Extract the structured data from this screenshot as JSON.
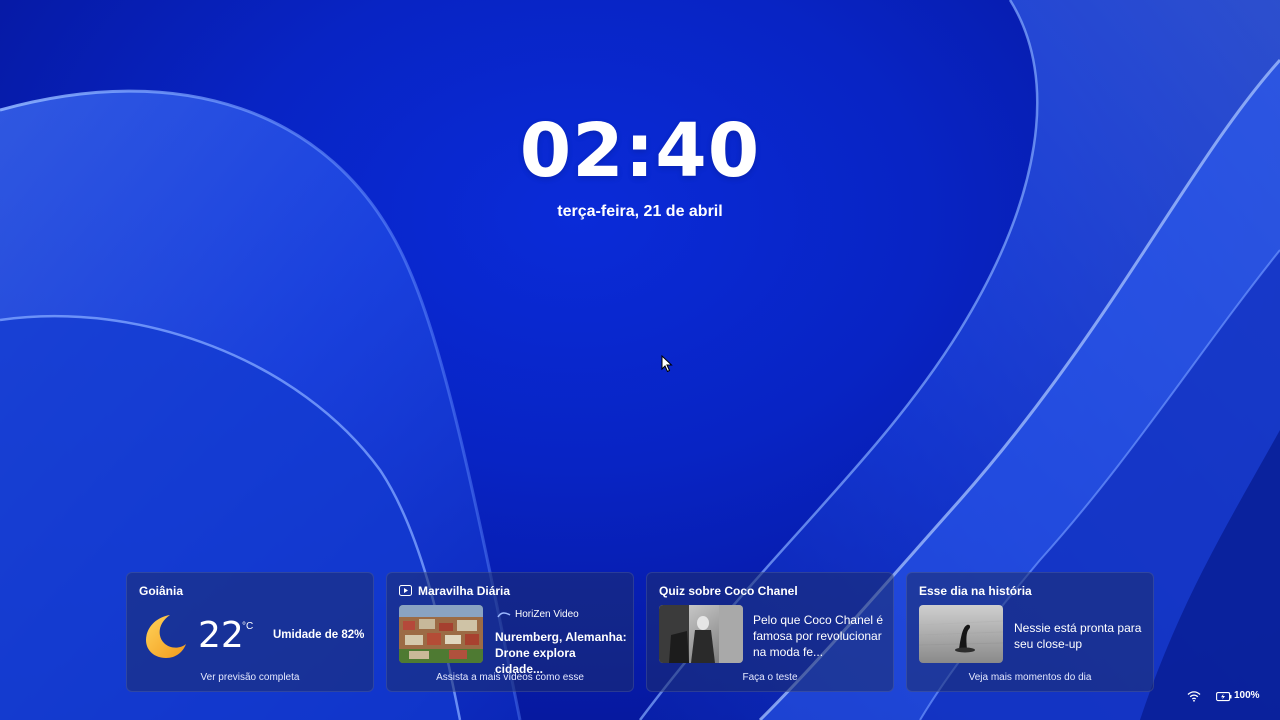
{
  "lock_screen": {
    "time": "02:40",
    "date": "terça-feira, 21 de abril"
  },
  "widgets": {
    "weather": {
      "city": "Goiânia",
      "icon": "moon-icon",
      "temperature": "22",
      "unit": "°C",
      "humidity": "Umidade de 82%",
      "footer": "Ver previsão completa"
    },
    "video": {
      "title": "Maravilha Diária",
      "icon": "play-video-icon",
      "source": "HoriZen Video",
      "headline": "Nuremberg, Alemanha: Drone explora cidade...",
      "footer": "Assista a mais vídeos como esse"
    },
    "quiz": {
      "title": "Quiz sobre Coco Chanel",
      "text": "Pelo que Coco Chanel é famosa por revolucionar na moda fe...",
      "footer": "Faça o teste"
    },
    "history": {
      "title": "Esse dia na história",
      "text": "Nessie está pronta para seu close-up",
      "footer": "Veja mais momentos do dia"
    }
  },
  "system_tray": {
    "wifi_icon": "wifi-icon",
    "battery_icon": "battery-icon",
    "battery_percent": "100%"
  }
}
